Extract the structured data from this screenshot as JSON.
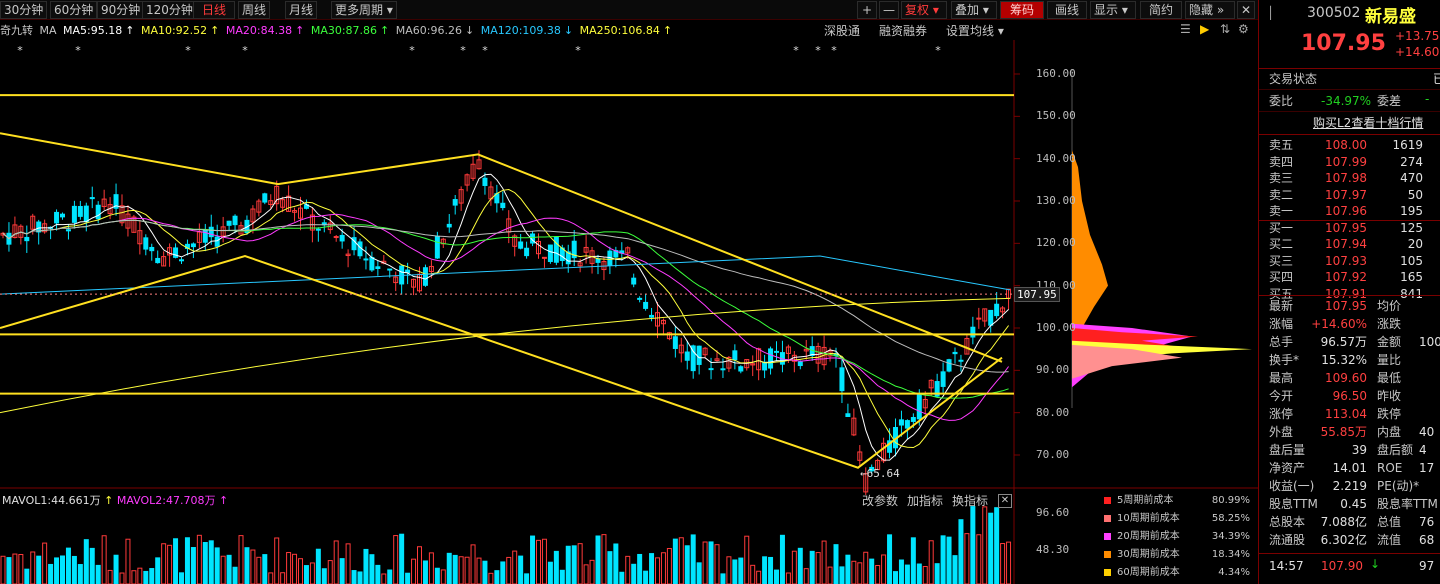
{
  "toolbar": {
    "periods": [
      "30分钟",
      "60分钟",
      "90分钟",
      "120分钟",
      "日线",
      "周线",
      "月线",
      "更多周期"
    ],
    "active_period": "日线",
    "right_buttons": [
      "+",
      "—",
      "复权",
      "叠加",
      "筹码",
      "画线",
      "显示",
      "简约",
      "隐藏"
    ]
  },
  "ma_bar": {
    "indicator": "奇九转",
    "ma_label": "MA",
    "items": [
      {
        "label": "MA5:95.18",
        "color": "#ffffff"
      },
      {
        "label": "MA10:92.52",
        "color": "#ffff3c"
      },
      {
        "label": "MA20:84.38",
        "color": "#ff3cff"
      },
      {
        "label": "MA30:87.86",
        "color": "#3cff3c"
      },
      {
        "label": "MA60:96.26",
        "color": "#bdbdbd"
      },
      {
        "label": "MA120:109.38",
        "color": "#28c8ff"
      },
      {
        "label": "MA250:106.84",
        "color": "#ffff3c"
      }
    ],
    "links": [
      "深股通",
      "融资融券",
      "设置均线"
    ]
  },
  "price_axis": {
    "ticks": [
      "160.00",
      "150.00",
      "140.00",
      "130.00",
      "120.00",
      "110.00",
      "100.00",
      "90.00",
      "80.00",
      "70.00"
    ],
    "current_price_tag": "107.95",
    "low_annotation": "←65.64"
  },
  "volume_panel": {
    "mavol1": "MAVOL1:44.661万",
    "mavol2": "MAVOL2:47.708万",
    "buttons": [
      "改参数",
      "加指标",
      "换指标"
    ],
    "axis": [
      "96.60",
      "48.30"
    ]
  },
  "cost_legend": [
    {
      "label": "5周期前成本",
      "value": "80.99%",
      "color": "#ff2020"
    },
    {
      "label": "10周期前成本",
      "value": "58.25%",
      "color": "#ff7070"
    },
    {
      "label": "20周期前成本",
      "value": "34.39%",
      "color": "#ff40ff"
    },
    {
      "label": "30周期前成本",
      "value": "18.34%",
      "color": "#ff8c00"
    },
    {
      "label": "60周期前成本",
      "value": "4.34%",
      "color": "#ffd000"
    }
  ],
  "stock": {
    "code": "300502",
    "name": "新易盛",
    "price": "107.95",
    "change": "+13.75",
    "change_pct": "+14.60%"
  },
  "quote": {
    "status_label": "交易状态",
    "weibi_label": "委比",
    "weibi": "-34.97%",
    "weicha_label": "委差",
    "l2_link": "购买L2查看十档行情",
    "asks": [
      {
        "label": "卖五",
        "price": "108.00",
        "vol": "1619"
      },
      {
        "label": "卖四",
        "price": "107.99",
        "vol": "274"
      },
      {
        "label": "卖三",
        "price": "107.98",
        "vol": "470"
      },
      {
        "label": "卖二",
        "price": "107.97",
        "vol": "50"
      },
      {
        "label": "卖一",
        "price": "107.96",
        "vol": "195"
      }
    ],
    "bids": [
      {
        "label": "买一",
        "price": "107.95",
        "vol": "125"
      },
      {
        "label": "买二",
        "price": "107.94",
        "vol": "20"
      },
      {
        "label": "买三",
        "price": "107.93",
        "vol": "105"
      },
      {
        "label": "买四",
        "price": "107.92",
        "vol": "165"
      },
      {
        "label": "买五",
        "price": "107.91",
        "vol": "841"
      }
    ],
    "stats": [
      {
        "k1": "最新",
        "v1": "107.95",
        "c1": "red",
        "k2": "均价",
        "v2": ""
      },
      {
        "k1": "涨幅",
        "v1": "+14.60%",
        "c1": "red",
        "k2": "涨跌",
        "v2": ""
      },
      {
        "k1": "总手",
        "v1": "96.57万",
        "c1": "wht",
        "k2": "金额",
        "v2": "100"
      },
      {
        "k1": "换手*",
        "v1": "15.32%",
        "c1": "wht",
        "k2": "量比",
        "v2": ""
      },
      {
        "k1": "最高",
        "v1": "109.60",
        "c1": "red",
        "k2": "最低",
        "v2": ""
      },
      {
        "k1": "今开",
        "v1": "96.50",
        "c1": "red",
        "k2": "昨收",
        "v2": ""
      },
      {
        "k1": "涨停",
        "v1": "113.04",
        "c1": "red",
        "k2": "跌停",
        "v2": ""
      },
      {
        "k1": "外盘",
        "v1": "55.85万",
        "c1": "red",
        "k2": "内盘",
        "v2": "40"
      },
      {
        "k1": "盘后量",
        "v1": "39",
        "c1": "wht",
        "k2": "盘后额",
        "v2": "4"
      },
      {
        "k1": "净资产",
        "v1": "14.01",
        "c1": "wht",
        "k2": "ROE",
        "v2": "17"
      },
      {
        "k1": "收益(一)",
        "v1": "2.219",
        "c1": "wht",
        "k2": "PE(动)*",
        "v2": ""
      },
      {
        "k1": "股息TTM",
        "v1": "0.45",
        "c1": "wht",
        "k2": "股息率TTM",
        "v2": ""
      },
      {
        "k1": "总股本",
        "v1": "7.088亿",
        "c1": "wht",
        "k2": "总值",
        "v2": "76"
      },
      {
        "k1": "流通股",
        "v1": "6.302亿",
        "c1": "wht",
        "k2": "流值",
        "v2": "68"
      }
    ],
    "tick": {
      "time": "14:57",
      "price": "107.90",
      "vol": "97"
    }
  }
}
